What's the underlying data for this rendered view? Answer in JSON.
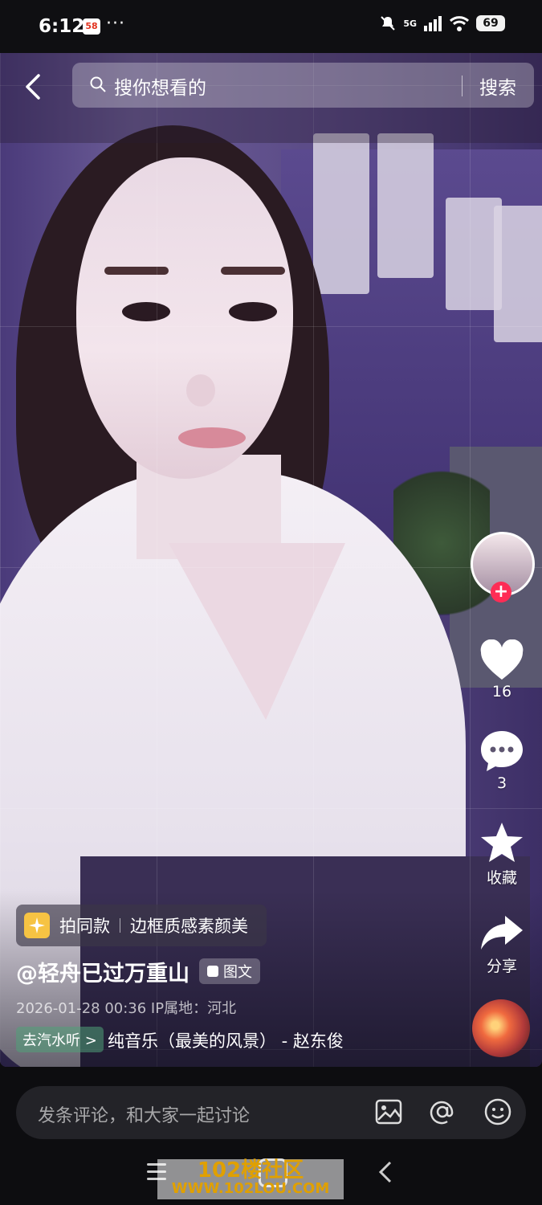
{
  "status_bar": {
    "time": "6:12",
    "app_badge": "58",
    "dots": "···",
    "network": "5G",
    "battery": "69"
  },
  "search": {
    "placeholder": "搜你想看的",
    "button": "搜索"
  },
  "actions": {
    "likes": "16",
    "comments": "3",
    "favorite_label": "收藏",
    "share_label": "分享"
  },
  "template_chip": {
    "label": "拍同款",
    "effect": "边框质感素颜美"
  },
  "post": {
    "author": "@轻舟已过万重山",
    "type": "图文",
    "meta": "2026-01-28 00:36  IP属地：河北",
    "music_chip": "去汽水听 >",
    "music": "纯音乐（最美的风景） - 赵东俊"
  },
  "comment": {
    "placeholder": "发条评论，和大家一起讨论"
  },
  "watermark": {
    "line1": "102楼社区",
    "line2": "WWW.102LOU.COM"
  },
  "colors": {
    "accent": "#fe2c55",
    "background": "#0d0d10"
  }
}
